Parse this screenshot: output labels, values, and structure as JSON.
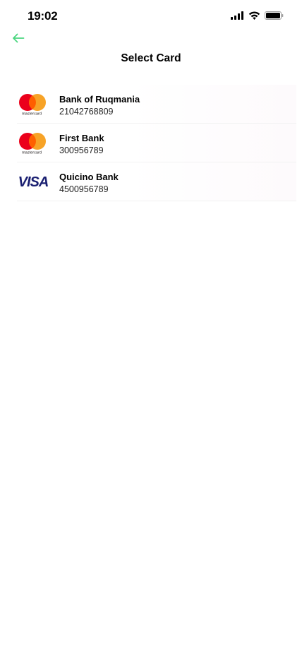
{
  "status_bar": {
    "time": "19:02"
  },
  "header": {
    "title": "Select Card",
    "back_icon": "arrow-left-icon"
  },
  "colors": {
    "accent": "#4cd680",
    "mastercard_red": "#eb001b",
    "mastercard_orange": "#f79e1b",
    "visa_blue": "#1a1f71"
  },
  "cards": [
    {
      "bank": "Bank of Ruqmania",
      "number": "21042768809",
      "brand": "mastercard",
      "brand_label": "mastercard"
    },
    {
      "bank": "First Bank",
      "number": "300956789",
      "brand": "mastercard",
      "brand_label": "mastercard"
    },
    {
      "bank": "Quicino Bank",
      "number": "4500956789",
      "brand": "visa",
      "brand_label": "VISA"
    }
  ]
}
